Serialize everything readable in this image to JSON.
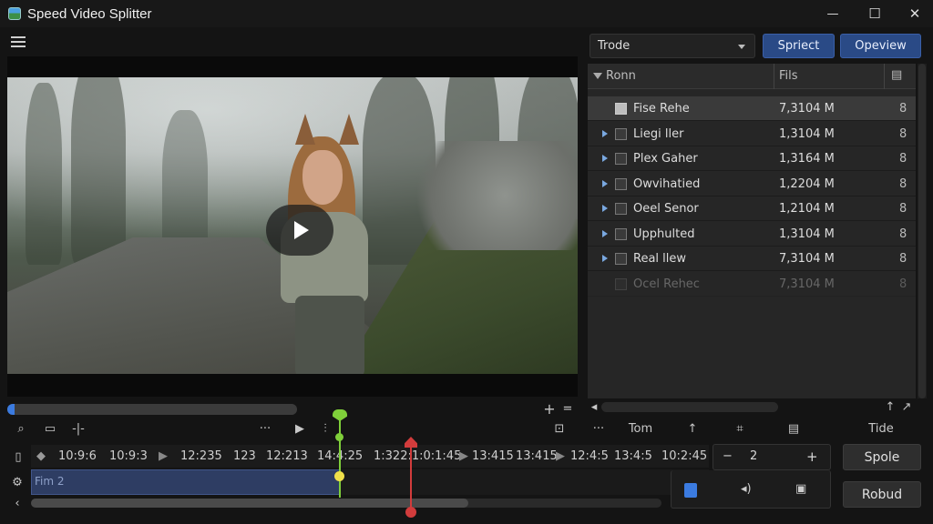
{
  "app": {
    "title": "Speed Video Splitter"
  },
  "window_controls": {
    "minimize": "—",
    "maximize": "☐",
    "close": "✕"
  },
  "panel": {
    "dropdown_value": "Trode",
    "btn_select": "Spriect",
    "btn_overview": "Opeview"
  },
  "list": {
    "headers": [
      "Ronn",
      "Fils"
    ],
    "rows": [
      {
        "name": "Fise Rehe",
        "size": "7,3104 M",
        "lock": "8",
        "selected": true,
        "expander": false
      },
      {
        "name": "Liegi ller",
        "size": "1,3104 M",
        "lock": "8",
        "selected": false,
        "expander": true
      },
      {
        "name": "Plex Gaher",
        "size": "1,3164 M",
        "lock": "8",
        "selected": false,
        "expander": true
      },
      {
        "name": "Owvihatied",
        "size": "1,2204 M",
        "lock": "8",
        "selected": false,
        "expander": true
      },
      {
        "name": "Oeel Senor",
        "size": "1,2104 M",
        "lock": "8",
        "selected": false,
        "expander": true
      },
      {
        "name": "Upphulted",
        "size": "1,3104 M",
        "lock": "8",
        "selected": false,
        "expander": true
      },
      {
        "name": "Real llew",
        "size": "7,3104 M",
        "lock": "8",
        "selected": false,
        "expander": true
      },
      {
        "name": "Ocel Rehec",
        "size": "7,3104 M",
        "lock": "8",
        "selected": false,
        "expander": false
      }
    ]
  },
  "toolbar": {
    "dots1": "···",
    "dots2": "···",
    "tom_label": "Tom",
    "tide_label": "Tide"
  },
  "ruler": {
    "ticks": [
      "10:9:6",
      "10:9:3",
      "12:235",
      "123",
      "12:213",
      "14:4:25",
      "1:322:1:0:1:45",
      "13:415",
      "13:415",
      "12:4:5",
      "13:4:5",
      "10:2:45"
    ]
  },
  "timeline": {
    "clip_label": "Fim 2"
  },
  "stepper": {
    "minus": "−",
    "value": "2",
    "plus": "+"
  },
  "side_buttons": {
    "spole": "Spole",
    "robud": "Robud"
  }
}
